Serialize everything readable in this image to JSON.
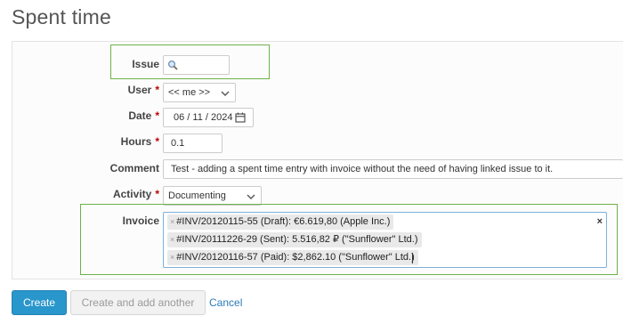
{
  "page": {
    "title": "Spent time"
  },
  "form": {
    "issue": {
      "label": "Issue",
      "value": ""
    },
    "user": {
      "label": "User",
      "value": "<< me >>"
    },
    "date": {
      "label": "Date",
      "value": "06 / 11 / 2024"
    },
    "hours": {
      "label": "Hours",
      "value": "0.1"
    },
    "comment": {
      "label": "Comment",
      "value": "Test - adding a spent time entry with invoice without the need of having linked issue to it."
    },
    "activity": {
      "label": "Activity",
      "value": "Documenting"
    },
    "invoice": {
      "label": "Invoice",
      "tags": [
        "#INV/20120115-55 (Draft): €6.619,80 (Apple Inc.)",
        "#INV/20111226-29 (Sent): 5.516,82 ₽ (\"Sunflower\" Ltd.)",
        "#INV/20120116-57 (Paid): $2,862.10 (\"Sunflower\" Ltd.)"
      ],
      "remove_glyph": "×",
      "clear_glyph": "×"
    },
    "required_marker": "*"
  },
  "actions": {
    "create": "Create",
    "create_another": "Create and add another",
    "cancel": "Cancel"
  },
  "colors": {
    "primary": "#2996cc",
    "highlight": "#6fb24a",
    "required": "#bb0000",
    "link": "#2a7cb8"
  },
  "icons": {
    "issue_search": "search-icon",
    "date_picker": "calendar-icon",
    "select": "chevron-down-icon"
  }
}
